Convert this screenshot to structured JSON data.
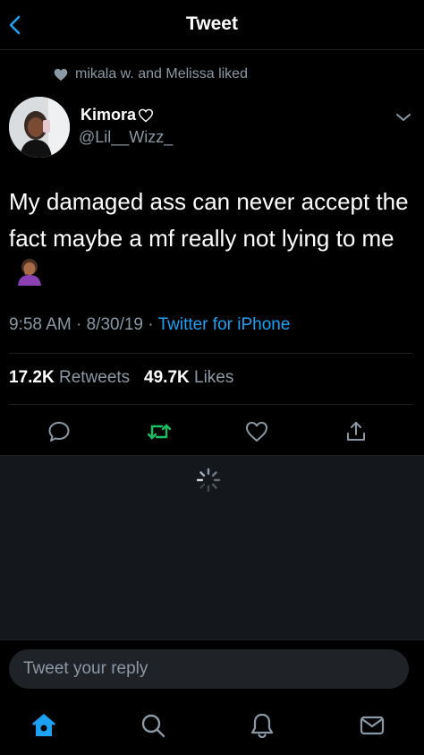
{
  "header": {
    "title": "Tweet"
  },
  "social_context": {
    "text": "mikala w. and Melissa liked"
  },
  "author": {
    "display_name": "Kimora",
    "handle": "@Lil__Wizz_"
  },
  "tweet": {
    "text": "My damaged ass can never accept the fact maybe a mf really not lying to me",
    "time": "9:58 AM",
    "date": "8/30/19",
    "source": "Twitter for iPhone"
  },
  "stats": {
    "retweets_count": "17.2K",
    "retweets_label": "Retweets",
    "likes_count": "49.7K",
    "likes_label": "Likes"
  },
  "reply": {
    "placeholder": "Tweet your reply"
  },
  "colors": {
    "accent": "#1da1f2",
    "retweet_active": "#17bf63",
    "secondary_text": "#8b98a5",
    "background": "#000000"
  }
}
